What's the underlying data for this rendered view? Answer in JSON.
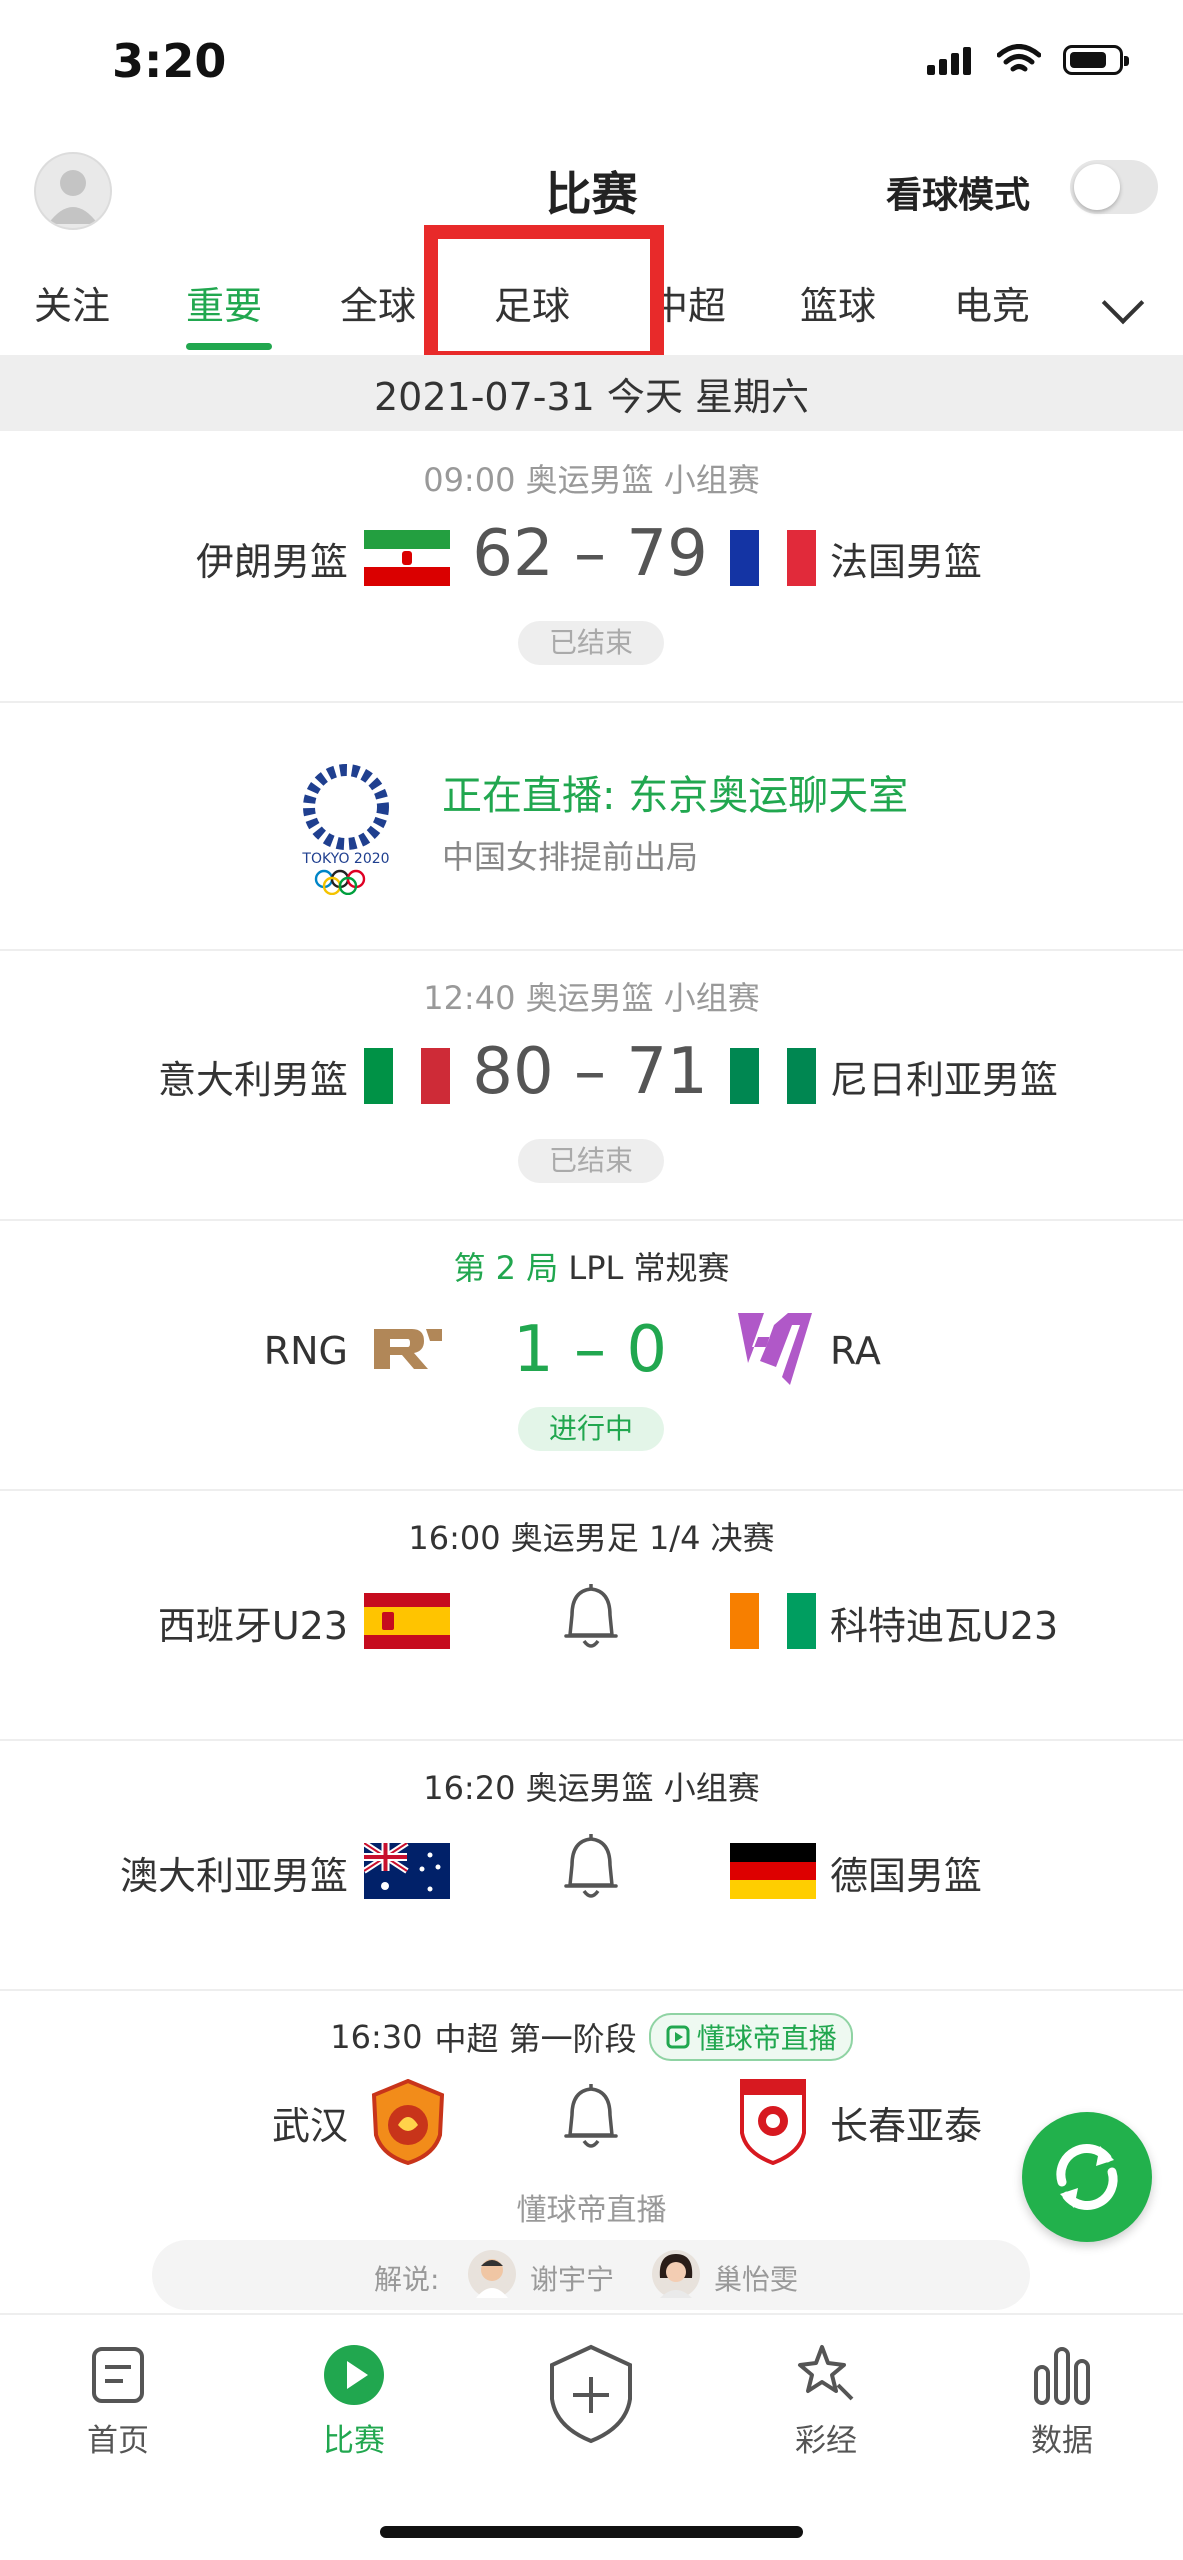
{
  "status_bar": {
    "time": "3:20"
  },
  "header": {
    "title": "比赛",
    "watch_mode_label": "看球模式"
  },
  "tabs": [
    "关注",
    "重要",
    "全球",
    "足球",
    "中超",
    "篮球",
    "电竞"
  ],
  "date_band": "2021-07-31 今天 星期六",
  "matches": [
    {
      "time": "09:00",
      "league": "奥运男篮 小组赛",
      "home": "伊朗男篮",
      "away": "法国男篮",
      "score": "62 – 79",
      "status": "已结束"
    },
    {
      "time": "12:40",
      "league": "奥运男篮 小组赛",
      "home": "意大利男篮",
      "away": "尼日利亚男篮",
      "score": "80 – 71",
      "status": "已结束"
    },
    {
      "round": "第 2 局",
      "league": "LPL 常规赛",
      "home": "RNG",
      "away": "RA",
      "score": "1 – 0",
      "status": "进行中"
    },
    {
      "time": "16:00",
      "league": "奥运男足 1/4 决赛",
      "home": "西班牙U23",
      "away": "科特迪瓦U23"
    },
    {
      "time": "16:20",
      "league": "奥运男篮 小组赛",
      "home": "澳大利亚男篮",
      "away": "德国男篮"
    },
    {
      "time": "16:30",
      "league": "中超 第一阶段",
      "badge": "懂球帝直播",
      "home": "武汉",
      "away": "长春亚泰",
      "broadcast": "懂球帝直播",
      "commentary_label": "解说:",
      "commentators": [
        "谢宇宁",
        "巢怡雯"
      ]
    }
  ],
  "banner": {
    "title": "正在直播: 东京奥运聊天室",
    "subtitle": "中国女排提前出局",
    "logo_text": "TOKYO 2020"
  },
  "bottom_nav": [
    "首页",
    "比赛",
    "",
    "彩经",
    "数据"
  ],
  "colors": {
    "accent": "#21a74f",
    "highlight": "#e82a2a"
  }
}
